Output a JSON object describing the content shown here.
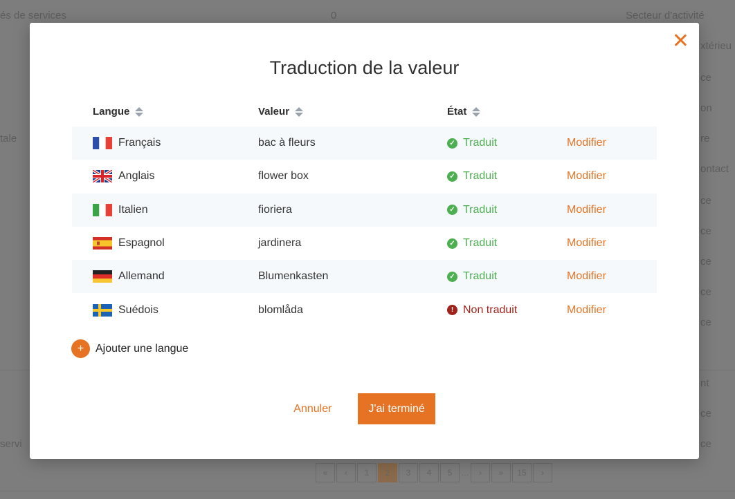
{
  "background": {
    "texts": [
      "és de services",
      "0",
      "Secteur d'activité",
      "xtérieu",
      "ce",
      "on",
      "tale",
      "re",
      "ontact",
      "ce",
      "ce",
      "ce",
      "ce",
      "ce",
      "nt",
      "ce",
      "servi",
      "ce"
    ],
    "pagination": [
      "«",
      "‹",
      "1",
      "2",
      "3",
      "4",
      "5",
      "…",
      "›",
      "»",
      "15",
      "›"
    ]
  },
  "modal": {
    "title": "Traduction de la valeur",
    "columns": {
      "language": "Langue",
      "value": "Valeur",
      "state": "État"
    },
    "rows": [
      {
        "flag": "flag-france",
        "language": "Français",
        "value": "bac à fleurs",
        "state": "Traduit",
        "state_type": "ok",
        "action": "Modifier"
      },
      {
        "flag": "flag-uk",
        "language": "Anglais",
        "value": "flower box",
        "state": "Traduit",
        "state_type": "ok",
        "action": "Modifier"
      },
      {
        "flag": "flag-italy",
        "language": "Italien",
        "value": "fioriera",
        "state": "Traduit",
        "state_type": "ok",
        "action": "Modifier"
      },
      {
        "flag": "flag-spain",
        "language": "Espagnol",
        "value": "jardinera",
        "state": "Traduit",
        "state_type": "ok",
        "action": "Modifier"
      },
      {
        "flag": "flag-germany",
        "language": "Allemand",
        "value": "Blumenkasten",
        "state": "Traduit",
        "state_type": "ok",
        "action": "Modifier"
      },
      {
        "flag": "flag-sweden",
        "language": "Suédois",
        "value": "blomlåda",
        "state": "Non traduit",
        "state_type": "ko",
        "action": "Modifier"
      }
    ],
    "add_language": "Ajouter une langue",
    "cancel_label": "Annuler",
    "done_label": "J'ai terminé"
  },
  "colors": {
    "accent": "#e67324",
    "success": "#4caf50",
    "error": "#a1221a"
  }
}
